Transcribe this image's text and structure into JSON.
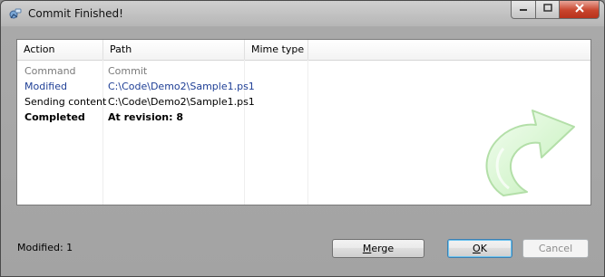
{
  "window": {
    "title": "Commit Finished!"
  },
  "table": {
    "columns": [
      "Action",
      "Path",
      "Mime type"
    ],
    "rows": [
      {
        "action": "Command",
        "path": "Commit",
        "style": "gray"
      },
      {
        "action": "Modified",
        "path": "C:\\Code\\Demo2\\Sample1.ps1",
        "style": "blue"
      },
      {
        "action": "Sending content",
        "path": "C:\\Code\\Demo2\\Sample1.ps1",
        "style": "normal"
      },
      {
        "action": "Completed",
        "path": "At revision: 8",
        "style": "bold"
      }
    ]
  },
  "status": {
    "text": "Modified: 1"
  },
  "buttons": {
    "merge": {
      "prefix": "",
      "accel": "M",
      "rest": "erge"
    },
    "ok": {
      "prefix": "",
      "accel": "O",
      "rest": "K"
    },
    "cancel": "Cancel"
  },
  "icons": {
    "app": "commit-app-icon",
    "decoration": "curved-arrow-icon"
  },
  "colors": {
    "modified_text": "#1f3f96",
    "command_text": "#7a7a7a",
    "arrow_fill": "#d9f7d4"
  }
}
